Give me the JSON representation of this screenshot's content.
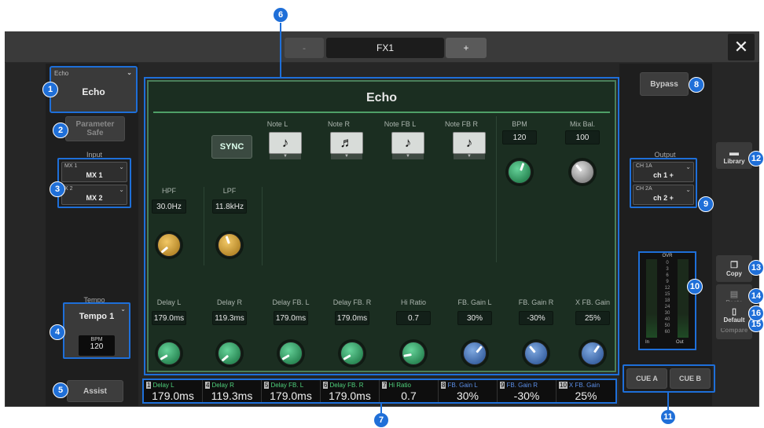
{
  "header": {
    "prev_label": "-",
    "title": "FX1",
    "next_label": "+",
    "close_icon": "close-icon"
  },
  "left": {
    "fx_type": {
      "small": "Echo",
      "main": "Echo"
    },
    "param_safe": "Parameter\nSafe",
    "input_label": "Input",
    "inputs": [
      {
        "small": "MX 1",
        "main": "MX 1"
      },
      {
        "small": "X 2",
        "main": "MX 2"
      }
    ],
    "tempo_label": "Tempo",
    "tempo_select": "Tempo 1",
    "bpm_label": "BPM",
    "bpm_value": "120",
    "assist": "Assist"
  },
  "panel": {
    "title": "Echo",
    "sync": "SYNC",
    "notes": [
      {
        "label": "Note L",
        "glyph": "♪"
      },
      {
        "label": "Note R",
        "glyph": "♬"
      },
      {
        "label": "Note FB L",
        "glyph": "♪"
      },
      {
        "label": "Note FB R",
        "glyph": "♪"
      }
    ],
    "bpm": {
      "label": "BPM",
      "value": "120"
    },
    "mix": {
      "label": "Mix Bal.",
      "value": "100"
    },
    "filters": [
      {
        "label": "HPF",
        "value": "30.0Hz"
      },
      {
        "label": "LPF",
        "value": "11.8kHz"
      }
    ],
    "params": [
      {
        "label": "Delay L",
        "value": "179.0ms"
      },
      {
        "label": "Delay R",
        "value": "119.3ms"
      },
      {
        "label": "Delay FB. L",
        "value": "179.0ms"
      },
      {
        "label": "Delay FB. R",
        "value": "179.0ms"
      },
      {
        "label": "Hi Ratio",
        "value": "0.7"
      },
      {
        "label": "FB. Gain L",
        "value": "30%"
      },
      {
        "label": "FB. Gain R",
        "value": "-30%"
      },
      {
        "label": "X FB. Gain",
        "value": "25%"
      }
    ]
  },
  "strip": [
    {
      "num": "1",
      "name": "Delay L",
      "value": "179.0ms",
      "color": "#4fd17d"
    },
    {
      "num": "4",
      "name": "Delay R",
      "value": "119.3ms",
      "color": "#4fd17d"
    },
    {
      "num": "5",
      "name": "Delay FB. L",
      "value": "179.0ms",
      "color": "#4fd17d"
    },
    {
      "num": "6",
      "name": "Delay FB. R",
      "value": "179.0ms",
      "color": "#4fd17d"
    },
    {
      "num": "7",
      "name": "Hi Ratio",
      "value": "0.7",
      "color": "#4fd17d"
    },
    {
      "num": "8",
      "name": "FB. Gain L",
      "value": "30%",
      "color": "#5b8ee6"
    },
    {
      "num": "9",
      "name": "FB. Gain R",
      "value": "-30%",
      "color": "#5b8ee6"
    },
    {
      "num": "10",
      "name": "X FB. Gain",
      "value": "25%",
      "color": "#5b8ee6"
    }
  ],
  "right": {
    "bypass": "Bypass",
    "output_label": "Output",
    "outputs": [
      {
        "small": "CH 1A",
        "main": "ch 1 +"
      },
      {
        "small": "CH 2A",
        "main": "ch 2 +"
      }
    ],
    "meter": {
      "over": "OVR",
      "scale": [
        "0",
        "3",
        "6",
        "9",
        "12",
        "15",
        "18",
        "24",
        "30",
        "40",
        "50",
        "60"
      ],
      "in": "In",
      "out": "Out"
    },
    "cue_a": "CUE A",
    "cue_b": "CUE B"
  },
  "side": {
    "library": "Library",
    "copy": "Copy",
    "paste": "Paste",
    "compare": "Compare",
    "default": "Default"
  },
  "callouts": [
    "1",
    "2",
    "3",
    "4",
    "5",
    "6",
    "7",
    "8",
    "9",
    "10",
    "11",
    "12",
    "13",
    "14",
    "15",
    "16"
  ]
}
